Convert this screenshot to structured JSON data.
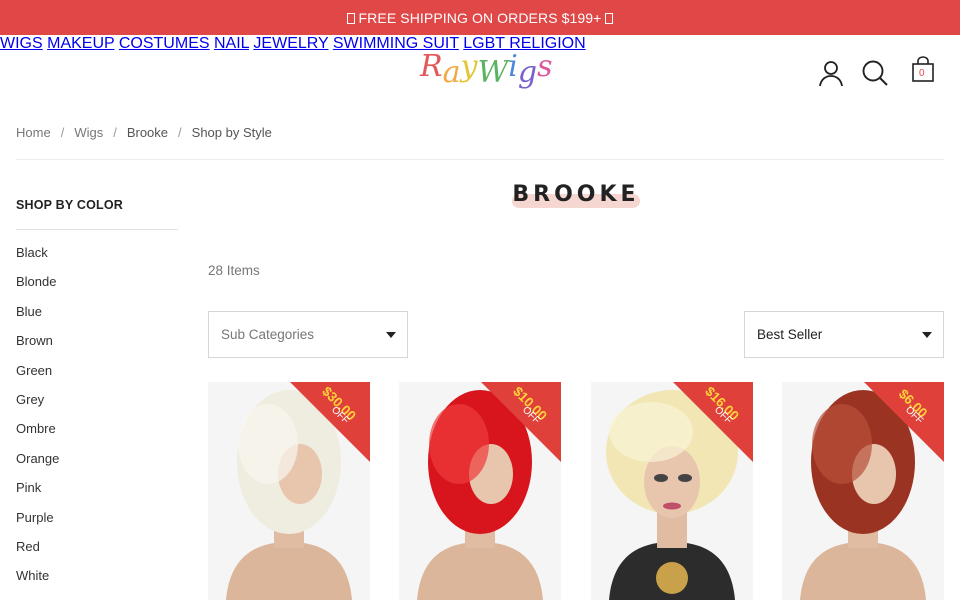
{
  "promo": {
    "text": "FREE SHIPPING ON ORDERS $199+"
  },
  "logo": {
    "text": "RayWigs",
    "letters": [
      "R",
      "a",
      "y",
      "W",
      "i",
      "g",
      "s"
    ],
    "colors": [
      "#e04848",
      "#f0a030",
      "#e0c020",
      "#4aaa50",
      "#3a7ad8",
      "#6a50c8",
      "#d84890"
    ]
  },
  "nav": {
    "items": [
      "WIGS",
      "MAKEUP",
      "COSTUMES",
      "NAIL",
      "JEWELRY",
      "SWIMMING SUIT",
      "LGBT RELIGION"
    ]
  },
  "header_icons": {
    "account": "user-icon",
    "search": "search-icon",
    "cart": "shopping-bag-icon",
    "cart_count": "0"
  },
  "breadcrumb": {
    "items": [
      "Home",
      "Wigs",
      "Brooke",
      "Shop by Style"
    ],
    "separator": "/"
  },
  "sidebar": {
    "title": "SHOP BY COLOR",
    "colors": [
      "Black",
      "Blonde",
      "Blue",
      "Brown",
      "Green",
      "Grey",
      "Ombre",
      "Orange",
      "Pink",
      "Purple",
      "Red",
      "White"
    ]
  },
  "page": {
    "title": "BROOKE",
    "item_count": "28 Items"
  },
  "filters": {
    "sub_categories_placeholder": "Sub Categories",
    "sort_selected": "Best Seller"
  },
  "products": [
    {
      "discount": "$30.00",
      "off": "OFF",
      "hair": "#efece0",
      "hair2": "#f8f6ee"
    },
    {
      "discount": "$10.00",
      "off": "OFF",
      "hair": "#d8141c",
      "hair2": "#f03a3a"
    },
    {
      "discount": "$16.00",
      "off": "OFF",
      "hair": "#f1e6b4",
      "hair2": "#faf4d6"
    },
    {
      "discount": "$6.00",
      "off": "OFF",
      "hair": "#9a3322",
      "hair2": "#b8503a"
    }
  ],
  "colors": {
    "promo_bg": "#e04848",
    "ribbon": "#e0403a",
    "ribbon_amount": "#ffd23c",
    "title_highlight": "#f6d6d0"
  }
}
